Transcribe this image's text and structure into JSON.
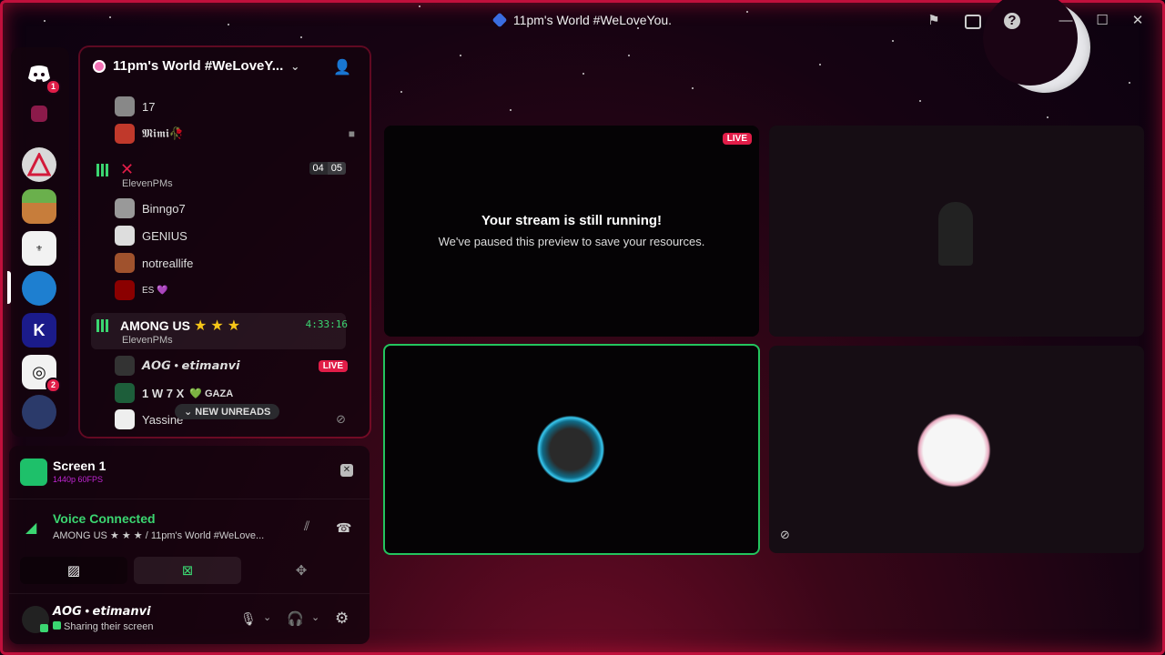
{
  "window": {
    "title": "11pm's World #WeLoveYou.",
    "minimize": "—",
    "maximize": "☐",
    "close": "✕"
  },
  "servers": [
    {
      "name": "discord-home",
      "badge": "1"
    },
    {
      "name": "server-2"
    },
    {
      "name": "server-aog"
    },
    {
      "name": "server-minecraft"
    },
    {
      "name": "server-3"
    },
    {
      "name": "server-4"
    },
    {
      "name": "server-k",
      "letter": "K"
    },
    {
      "name": "server-5",
      "badge": "2"
    },
    {
      "name": "server-6"
    }
  ],
  "channel_list": {
    "guild_name": "11pm's World #WeLoveY...",
    "users_top": [
      {
        "name": "17"
      },
      {
        "name": "𝕸𝖎𝖒𝖎🥀"
      }
    ],
    "vc1": {
      "symbol": "✕",
      "sub": "ElevenPMs",
      "count_a": "04",
      "count_b": "05",
      "users": [
        "Binngo7",
        "GENIUS",
        "notreallife",
        "ES 💜"
      ]
    },
    "vc2": {
      "name": "AMONG US",
      "sub": "ElevenPMs",
      "timer": "4:33:16",
      "stars": [
        "★",
        "★",
        "★"
      ],
      "users": [
        {
          "name": "𝘼𝙊𝙂 • 𝙚𝙩𝙞𝙢𝙖𝙣𝙫𝙞",
          "live": "LIVE"
        },
        {
          "name": "1 W 7 X",
          "tag": "💚 GAZA"
        },
        {
          "name": "Yassine"
        }
      ]
    },
    "new_unreads": "NEW UNREADS"
  },
  "stream_panel": {
    "title": "Screen 1",
    "quality": "1440p 60FPS"
  },
  "voice": {
    "status": "Voice Connected",
    "location": "AMONG US ★ ★ ★ / 11pm's World #WeLove..."
  },
  "user": {
    "name": "𝘼𝙊𝙂 • 𝙚𝙩𝙞𝙢𝙖𝙣𝙫𝙞",
    "status": "Sharing their screen"
  },
  "stream_tile": {
    "live": "LIVE",
    "headline": "Your stream is still running!",
    "message": "We've paused this preview to save your resources."
  },
  "colors": {
    "accent_red": "#e11d48",
    "voice_green": "#3bd671",
    "star": "#f5c518"
  }
}
